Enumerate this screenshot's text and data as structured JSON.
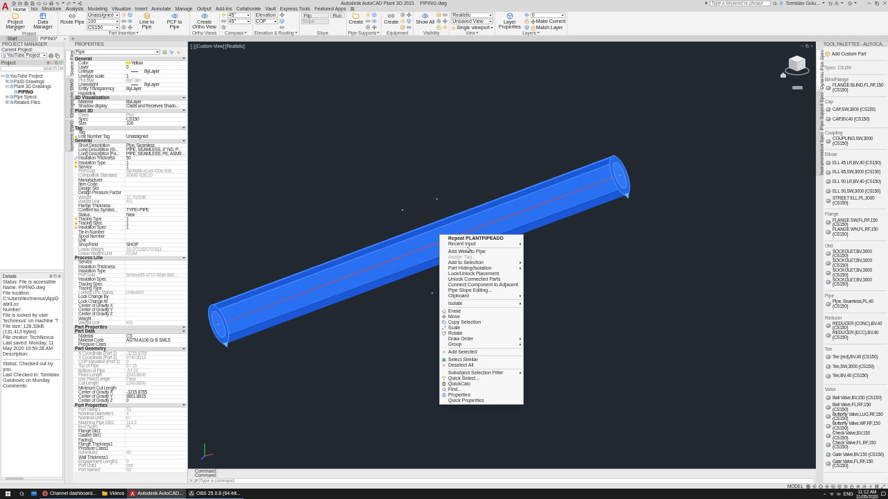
{
  "title_bar": {
    "logo": "A",
    "app_title": "Autodesk AutoCAD Plant 3D 2021",
    "file_name": "PIPING.dwg",
    "search": {
      "placeholder": "Type a keyword or phrase"
    },
    "user": "Tomislav Golu..."
  },
  "ribbon": {
    "tabs": [
      {
        "label": "Home",
        "selected": true
      },
      {
        "label": "Iso",
        "selected": false
      },
      {
        "label": "Structure",
        "selected": false
      },
      {
        "label": "Analysis",
        "selected": false
      },
      {
        "label": "Modeling",
        "selected": false
      },
      {
        "label": "Visualize",
        "selected": false
      },
      {
        "label": "Insert",
        "selected": false
      },
      {
        "label": "Annotate",
        "selected": false
      },
      {
        "label": "Manage",
        "selected": false
      },
      {
        "label": "Output",
        "selected": false
      },
      {
        "label": "Add-ins",
        "selected": false
      },
      {
        "label": "Collaborate",
        "selected": false
      },
      {
        "label": "Vault",
        "selected": false
      },
      {
        "label": "Express Tools",
        "selected": false
      },
      {
        "label": "Featured Apps",
        "selected": false
      }
    ],
    "panels": [
      {
        "label": "Project",
        "menu": false,
        "items": [
          {
            "kind": "large",
            "label": "Project Manager",
            "menu": true
          },
          {
            "kind": "large",
            "label": "Data Manager",
            "menu": false
          }
        ]
      },
      {
        "label": "Part Insertion",
        "menu": true,
        "items": [
          {
            "kind": "large",
            "label": "Route Pipe",
            "menu": false
          },
          {
            "kind": "stack",
            "rows": [
              {
                "kind": "dropdown",
                "value": "Unassigned"
              },
              {
                "kind": "dropdown",
                "value": "100"
              },
              {
                "kind": "dropdown",
                "value": "CS150"
              }
            ]
          },
          {
            "kind": "icons"
          },
          {
            "kind": "icons"
          },
          {
            "kind": "large",
            "label": "Line to Pipe",
            "menu": false
          },
          {
            "kind": "large",
            "label": "PCF to Pipe",
            "menu": false
          }
        ]
      },
      {
        "label": "Ortho Views",
        "menu": false,
        "items": [
          {
            "kind": "large",
            "label": "Create Ortho View",
            "menu": false
          }
        ]
      },
      {
        "label": "Compass",
        "menu": true,
        "items": [
          {
            "kind": "icons"
          },
          {
            "kind": "stack",
            "rows": [
              {
                "kind": "dropdown",
                "value": "45°"
              },
              {
                "kind": "dropdown",
                "value": "45°"
              }
            ]
          }
        ]
      },
      {
        "label": "Elevation & Routing",
        "menu": true,
        "items": [
          {
            "kind": "stack",
            "rows": [
              {
                "kind": "field",
                "value": "Elevation",
                "disabled": false
              },
              {
                "kind": "dropdown",
                "value": "COP"
              }
            ]
          },
          {
            "kind": "icons"
          }
        ]
      },
      {
        "label": "Slope",
        "menu": false,
        "items": [
          {
            "kind": "stack",
            "rows": [
              {
                "kind": "boxbutton",
                "label": "Flip"
              },
              {
                "kind": "field",
                "placeholder": "Slope",
                "disabled": true
              }
            ]
          },
          {
            "kind": "stack",
            "rows": [
              {
                "kind": "boxbutton",
                "label": "Run"
              }
            ]
          }
        ]
      },
      {
        "label": "Pipe Supports",
        "menu": true,
        "items": [
          {
            "kind": "large",
            "label": "Create",
            "menu": false
          },
          {
            "kind": "icons"
          },
          {
            "kind": "icons"
          }
        ]
      },
      {
        "label": "Equipment",
        "menu": false,
        "items": [
          {
            "kind": "large",
            "label": "Create",
            "menu": false
          },
          {
            "kind": "icons"
          },
          {
            "kind": "icons"
          }
        ]
      },
      {
        "label": "Visibility",
        "menu": false,
        "items": [
          {
            "kind": "large",
            "label": "Show All",
            "menu": false
          },
          {
            "kind": "icons"
          },
          {
            "kind": "icons"
          }
        ]
      },
      {
        "label": "View",
        "menu": true,
        "items": [
          {
            "kind": "stack",
            "rows": [
              {
                "kind": "dropdown",
                "value": "Realistic"
              },
              {
                "kind": "dropdown",
                "value": "Unsaved View"
              },
              {
                "kind": "button",
                "label": "Single viewport",
                "menu": true
              }
            ]
          }
        ]
      },
      {
        "label": "Layers",
        "menu": true,
        "items": [
          {
            "kind": "large",
            "label": "Layer Properties",
            "menu": false
          },
          {
            "kind": "icons"
          },
          {
            "kind": "stack",
            "rows": [
              {
                "kind": "dropdown",
                "value": "0"
              },
              {
                "kind": "button",
                "label": "Make Current",
                "menu": false
              },
              {
                "kind": "button",
                "label": "Match Layer",
                "menu": false
              }
            ]
          }
        ]
      }
    ]
  },
  "file_tabs": [
    {
      "label": "Start",
      "selected": false
    },
    {
      "label": "PIPING*",
      "selected": true
    }
  ],
  "project_manager": {
    "title": "PROJECT MANAGER",
    "current_label": "Current Project:",
    "current_project": "YouTube Project",
    "section": "Project",
    "search": {
      "placeholder": "search"
    },
    "tree": [
      {
        "label": "YouTube Project",
        "expanded": true,
        "selected": false,
        "children": [
          {
            "label": "P&ID Drawings",
            "expanded": false,
            "selected": false
          },
          {
            "label": "Plant 3D Drawings",
            "expanded": true,
            "selected": false,
            "children": [
              {
                "label": "PIPING",
                "selected": true
              }
            ]
          },
          {
            "label": "Pipe Specs",
            "expanded": false,
            "selected": false
          },
          {
            "label": "Related Files",
            "expanded": false,
            "selected": false
          }
        ]
      }
    ],
    "side_tabs": [
      {
        "label": "Source Files",
        "selected": true
      },
      {
        "label": "Orthographic DWG",
        "selected": false
      },
      {
        "label": "Isometric DWG",
        "selected": false
      }
    ],
    "details": {
      "title": "Details",
      "lines": [
        "Status: File is accessible",
        "Name: PIPING.dwg",
        "File location: C:\\Users\\technexus\\AppData\\Loc",
        "Number:",
        "File is locked by user 'technexus' on machine 'T",
        "File size: 128.33kB (131,413 bytes)",
        "File creator: TechNexus",
        "Last saved: Monday, 11 May 2020 10:59:28 AM",
        "Description:"
      ],
      "checkin": [
        "Status: Checked out by you.",
        "Last Checked in: Tomislav Golubovic on Monday",
        "Comments:"
      ]
    }
  },
  "properties": {
    "title": "PROPERTIES",
    "selection": "Pipe",
    "sections": [
      {
        "title": "General",
        "expanded": true,
        "rows": [
          {
            "name": "Color",
            "value": "Yellow",
            "kind": "swatch",
            "color": "#ffff00",
            "disabled": false
          },
          {
            "name": "Layer",
            "value": "0",
            "kind": "text",
            "disabled": false
          },
          {
            "name": "Linetype",
            "value": "ByLayer",
            "kind": "linetype",
            "disabled": false
          },
          {
            "name": "Linetype scale",
            "value": "1",
            "kind": "text",
            "disabled": false
          },
          {
            "name": "Plot style",
            "value": "ByColor",
            "kind": "text",
            "disabled": true
          },
          {
            "name": "Lineweight",
            "value": "ByLayer",
            "kind": "linetype",
            "disabled": false
          },
          {
            "name": "Entity Transparency",
            "value": "ByLayer",
            "kind": "text",
            "disabled": false
          },
          {
            "name": "Hyperlink",
            "kind": "text",
            "disabled": false
          }
        ]
      },
      {
        "title": "3D Visualization",
        "expanded": true,
        "rows": [
          {
            "name": "Material",
            "value": "ByLayer",
            "kind": "text",
            "disabled": false
          },
          {
            "name": "Shadow display",
            "value": "Casts and Receives Shado...",
            "kind": "text",
            "disabled": false
          }
        ]
      },
      {
        "title": "Plant 3D",
        "expanded": true,
        "rows": [
          {
            "name": "Class",
            "value": "Pipe",
            "kind": "text",
            "disabled": true
          },
          {
            "name": "Spec",
            "value": "CS150",
            "kind": "text",
            "disabled": false
          },
          {
            "name": "Size",
            "value": "100",
            "kind": "text",
            "disabled": false
          }
        ]
      },
      {
        "title": "Tag",
        "expanded": true,
        "rows": [
          {
            "name": "Tag",
            "kind": "text",
            "disabled": false
          },
          {
            "name": "Line Number Tag",
            "value": "Unassigned",
            "kind": "linked",
            "disabled": false
          }
        ]
      },
      {
        "title": "General",
        "expanded": true,
        "rows": [
          {
            "name": "Short Description",
            "value": "Pipe, Seamless",
            "kind": "text",
            "disabled": false
          },
          {
            "name": "Long Description (Si...",
            "value": "PIPE, SEAMLESS, 4\" ND, P...",
            "kind": "text",
            "disabled": false
          },
          {
            "name": "Long Description (Fa...",
            "value": "PIPE, SEAMLESS, PE, ASME...",
            "kind": "text",
            "disabled": false
          },
          {
            "name": "Insulation Thickness",
            "value": "50",
            "kind": "edited",
            "disabled": false
          },
          {
            "name": "Insulation Type",
            "value": "1",
            "kind": "linked",
            "disabled": false
          },
          {
            "name": "Service",
            "value": "1",
            "kind": "linked",
            "disabled": false
          },
          {
            "name": "PnPGuid",
            "value": "fab4fa8b-e1ad-43de-8d6...",
            "kind": "text",
            "disabled": true
          },
          {
            "name": "Compatible Standard",
            "value": "ASME B36.10",
            "kind": "text",
            "disabled": true
          },
          {
            "name": "Manufacturer",
            "kind": "text",
            "disabled": false
          },
          {
            "name": "Item Code",
            "kind": "text",
            "disabled": false
          },
          {
            "name": "Design Std",
            "kind": "text",
            "disabled": false
          },
          {
            "name": "Design Pressure Factor",
            "kind": "text",
            "disabled": false
          },
          {
            "name": "Weight",
            "value": "37.702998",
            "kind": "text",
            "disabled": true
          },
          {
            "name": "Weight Unit",
            "value": "KG",
            "kind": "text",
            "disabled": true
          },
          {
            "name": "Flange Thickness",
            "kind": "text",
            "disabled": false
          },
          {
            "name": "Content Iso Symbol...",
            "value": "TYPE=PIPE",
            "kind": "text",
            "disabled": false
          },
          {
            "name": "Status",
            "value": "New",
            "kind": "text",
            "disabled": false
          },
          {
            "name": "Tracing Type",
            "value": "1",
            "kind": "linked",
            "disabled": false
          },
          {
            "name": "Tracing Spec",
            "value": "1",
            "kind": "linked",
            "disabled": false
          },
          {
            "name": "Insulation Spec",
            "value": "1",
            "kind": "linked",
            "disabled": false
          },
          {
            "name": "Tie-In Number",
            "kind": "text",
            "disabled": false
          },
          {
            "name": "Spool Number",
            "kind": "text",
            "disabled": false
          },
          {
            "name": "Unit",
            "kind": "text",
            "disabled": false
          },
          {
            "name": "Shop/Field",
            "value": "SHOP",
            "kind": "text",
            "disabled": false
          },
          {
            "name": "Linear Weight",
            "value": "16.0721820707611",
            "kind": "text",
            "disabled": true
          },
          {
            "name": "Linear Weight Unit",
            "value": "KG/M",
            "kind": "text",
            "disabled": true
          }
        ]
      },
      {
        "title": "Process Line",
        "expanded": true,
        "rows": [
          {
            "name": "Service",
            "kind": "text",
            "disabled": false
          },
          {
            "name": "Insulation Thickness",
            "kind": "text",
            "disabled": false
          },
          {
            "name": "Insulation Type",
            "kind": "text",
            "disabled": false
          },
          {
            "name": "PnPGuid",
            "value": "5e0eee85-a710-40ab-8a6...",
            "kind": "text",
            "disabled": true
          },
          {
            "name": "Insulation Spec",
            "kind": "text",
            "disabled": false
          },
          {
            "name": "Tracing Spec",
            "kind": "text",
            "disabled": false
          },
          {
            "name": "Tracing Type",
            "kind": "text",
            "disabled": false
          },
          {
            "name": "Locked Line Status",
            "value": "Unlocked",
            "kind": "text",
            "disabled": true
          },
          {
            "name": "Lock Change By",
            "kind": "text",
            "disabled": false
          },
          {
            "name": "Lock Change At",
            "kind": "text",
            "disabled": false
          },
          {
            "name": "Center of Gravity X",
            "kind": "text",
            "disabled": false
          },
          {
            "name": "Center of Gravity Y",
            "kind": "text",
            "disabled": false
          },
          {
            "name": "Center of Gravity Z",
            "kind": "text",
            "disabled": false
          },
          {
            "name": "Weight",
            "kind": "text",
            "disabled": false
          },
          {
            "name": "Weight Unit",
            "value": "KG",
            "kind": "text",
            "disabled": true
          }
        ]
      },
      {
        "title": "Part Properties",
        "expanded": true
      },
      {
        "title": "Part Data",
        "expanded": true,
        "rows": [
          {
            "name": "Material",
            "value": "CS",
            "kind": "text",
            "disabled": false
          },
          {
            "name": "Material Code",
            "value": "ASTM A106 Gr B SMLS",
            "kind": "text",
            "disabled": false
          },
          {
            "name": "Pressure Class",
            "kind": "text",
            "disabled": false
          }
        ]
      },
      {
        "title": "Part Geometry",
        "expanded": true,
        "rows": [
          {
            "name": "X Coordinate (Port 1)",
            "value": "-3215.8785",
            "kind": "text",
            "disabled": true
          },
          {
            "name": "Y Coordinate (Port 1)",
            "value": "9740.8513",
            "kind": "text",
            "disabled": true
          },
          {
            "name": "COP Elevation (Port 1)",
            "value": "0",
            "kind": "text",
            "disabled": true
          },
          {
            "name": "Top of Pipe",
            "value": "57.15",
            "kind": "text",
            "disabled": true
          },
          {
            "name": "Bottom of Pipe",
            "value": "-57.15",
            "kind": "text",
            "disabled": true
          },
          {
            "name": "Fixed Length",
            "value": "2343.8600",
            "kind": "text",
            "disabled": true
          },
          {
            "name": "Use Fixed Length",
            "value": "False",
            "kind": "text",
            "disabled": true
          },
          {
            "name": "Cut Length",
            "value": "2343.8600",
            "kind": "text",
            "disabled": true
          },
          {
            "name": "Minimum Cut Length",
            "kind": "text",
            "disabled": false
          },
          {
            "name": "Center of Gravity X",
            "value": "-3215.8785",
            "kind": "text",
            "disabled": false
          },
          {
            "name": "Center of Gravity Y",
            "value": "9801.8815",
            "kind": "text",
            "disabled": false
          },
          {
            "name": "Center of Gravity Z",
            "value": "0",
            "kind": "text",
            "disabled": false
          }
        ]
      },
      {
        "title": "Port Properties",
        "expanded": true,
        "rows": [
          {
            "name": "Port Name1",
            "value": "S1",
            "kind": "text",
            "disabled": true
          },
          {
            "name": "Nominal Diameter1",
            "value": "4",
            "kind": "text",
            "disabled": true
          },
          {
            "name": "Nominal Unit1",
            "value": "in",
            "kind": "text",
            "disabled": true
          },
          {
            "name": "Matching Pipe OD1",
            "value": "114.3",
            "kind": "text",
            "disabled": true
          },
          {
            "name": "End Type1",
            "value": "PL",
            "kind": "text",
            "disabled": true
          },
          {
            "name": "Flange Std1",
            "kind": "text",
            "disabled": false
          },
          {
            "name": "Gasket Std1",
            "kind": "text",
            "disabled": false
          },
          {
            "name": "Facing1",
            "kind": "text",
            "disabled": false
          },
          {
            "name": "Flange Thickness1",
            "kind": "text",
            "disabled": false
          },
          {
            "name": "Pressure Class1",
            "kind": "text",
            "disabled": false
          },
          {
            "name": "Schedule1",
            "value": "40",
            "kind": "text",
            "disabled": true
          },
          {
            "name": "Wall Thickness1",
            "kind": "text",
            "disabled": false
          },
          {
            "name": "Engagement Length1",
            "value": "0",
            "kind": "text",
            "disabled": true
          },
          {
            "name": "Port Unit1",
            "value": "mm",
            "kind": "text",
            "disabled": true
          },
          {
            "name": "Port Name2",
            "value": "S2",
            "kind": "text",
            "disabled": true
          }
        ]
      }
    ]
  },
  "viewport": {
    "controls": [
      "[-]",
      "[Custom View]",
      "[Realistic]"
    ]
  },
  "context_menu": {
    "items": [
      {
        "kind": "plain",
        "label": "Repeat PLANTPIPEADD",
        "submenu": false,
        "disabled": false,
        "default": true
      },
      {
        "kind": "plain",
        "label": "Recent Input",
        "submenu": true,
        "disabled": false,
        "default": false
      },
      {
        "kind": "separator"
      },
      {
        "kind": "plain",
        "label": "Add Weld to Pipe",
        "submenu": false,
        "disabled": false,
        "default": false
      },
      {
        "kind": "plain",
        "label": "Assign Tag...",
        "submenu": false,
        "disabled": true,
        "default": false
      },
      {
        "kind": "plain",
        "label": "Add to Selection",
        "submenu": true,
        "disabled": false,
        "default": false
      },
      {
        "kind": "plain",
        "label": "Part Hiding/Isolation",
        "submenu": true,
        "disabled": false,
        "default": false
      },
      {
        "kind": "plain",
        "label": "Lock/Unlock Placement",
        "submenu": false,
        "disabled": false,
        "default": false
      },
      {
        "kind": "plain",
        "label": "Unlock Connected Parts",
        "submenu": false,
        "disabled": false,
        "default": false
      },
      {
        "kind": "plain",
        "label": "Connect Component to Adjacent",
        "submenu": false,
        "disabled": false,
        "default": false
      },
      {
        "kind": "plain",
        "label": "Pipe Slope Editing...",
        "submenu": false,
        "disabled": false,
        "default": false
      },
      {
        "kind": "plain",
        "label": "Clipboard",
        "submenu": true,
        "disabled": false,
        "default": false
      },
      {
        "kind": "separator"
      },
      {
        "kind": "plain",
        "label": "Isolate",
        "submenu": true,
        "disabled": false,
        "default": false
      },
      {
        "kind": "separator"
      },
      {
        "kind": "erase",
        "label": "Erase",
        "submenu": false,
        "disabled": false,
        "default": false
      },
      {
        "kind": "move",
        "label": "Move",
        "submenu": false,
        "disabled": false,
        "default": false
      },
      {
        "kind": "copy",
        "label": "Copy Selection",
        "submenu": false,
        "disabled": false,
        "default": false
      },
      {
        "kind": "scale",
        "label": "Scale",
        "submenu": false,
        "disabled": false,
        "default": false
      },
      {
        "kind": "rotate",
        "label": "Rotate",
        "submenu": false,
        "disabled": false,
        "default": false
      },
      {
        "kind": "plain",
        "label": "Draw Order",
        "submenu": true,
        "disabled": false,
        "default": false
      },
      {
        "kind": "plain",
        "label": "Group",
        "submenu": true,
        "disabled": false,
        "default": false
      },
      {
        "kind": "separator"
      },
      {
        "kind": "add",
        "label": "Add Selected",
        "submenu": false,
        "disabled": false,
        "default": false
      },
      {
        "kind": "separator"
      },
      {
        "kind": "similar",
        "label": "Select Similar",
        "submenu": false,
        "disabled": false,
        "default": false
      },
      {
        "kind": "deselect",
        "label": "Deselect All",
        "submenu": false,
        "disabled": false,
        "default": false
      },
      {
        "kind": "separator"
      },
      {
        "kind": "plain",
        "label": "Subobject Selection Filter",
        "submenu": true,
        "disabled": false,
        "default": false
      },
      {
        "kind": "quickselect",
        "label": "Quick Select...",
        "submenu": false,
        "disabled": false,
        "default": false
      },
      {
        "kind": "calc",
        "label": "QuickCalc",
        "submenu": false,
        "disabled": false,
        "default": false
      },
      {
        "kind": "find",
        "label": "Find...",
        "submenu": false,
        "disabled": false,
        "default": false
      },
      {
        "kind": "properties",
        "label": "Properties",
        "submenu": false,
        "disabled": false,
        "default": false
      },
      {
        "kind": "plain",
        "label": "Quick Properties",
        "submenu": false,
        "disabled": false,
        "default": false
      }
    ]
  },
  "command_line": {
    "history": [
      "Command:",
      "Command:"
    ],
    "placeholder": "Type a command"
  },
  "tool_palettes": {
    "title": "TOOL PALETTES - AUTOCA...",
    "tabs": [
      {
        "label": "Dynamic Pipe Spec",
        "selected": true
      },
      {
        "label": "Pipe Support Spec",
        "selected": false
      },
      {
        "label": "Instrumentation Spec",
        "selected": false
      }
    ],
    "add_part": "Add Custom Part",
    "spec": "Spec: CS150",
    "groups": [
      {
        "name": "BlindFlange",
        "items": [
          "FLANGE BLIND,FL,RF,150 (CS150)"
        ]
      },
      {
        "name": "Cap",
        "items": [
          "CAP,SW,3000 (CS150)",
          "CAP,BV,40 (CS150)"
        ]
      },
      {
        "name": "Coupling",
        "items": [
          "COUPLING,SW,3000 (CS150)"
        ]
      },
      {
        "name": "Elbow",
        "items": [
          "ELL 45 LR,BV,40 (CS150)",
          "ELL 45,SW,3000 (CS150)",
          "ELL 90 LR,BV,40 (CS150)",
          "ELL 90,SW,3000 (CS150)",
          "STREET ELL,PL,3000 (CS150)"
        ]
      },
      {
        "name": "Flange",
        "items": [
          "FLANGE SW,FL,RF,150 (CS150)",
          "FLANGE WN,FL,RF,150 (CS150)"
        ]
      },
      {
        "name": "Olet",
        "items": [
          "SOCKOLET,BV,3000 (CS150)",
          "SOCKOLET,BV,3000 (CS150)",
          "SOCKOLET,BV,3000 (CS150)",
          "SOCKOLET,BV,3000 (CS150)"
        ]
      },
      {
        "name": "Pipe",
        "items": [
          "Pipe, Seamless,PL,40 (CS150)"
        ]
      },
      {
        "name": "Reducer",
        "items": [
          "REDUCER (CONC),BV,40 (CS150)",
          "REDUCER (ECC),BV,40 (CS150)"
        ]
      },
      {
        "name": "Tee",
        "items": [
          "Tee (red),BV,40 (CS150)",
          "Tee,SW,3000 (CS150)",
          "Tee,BV,40 (CS150)"
        ]
      },
      {
        "name": "Valve",
        "items": [
          "Ball Valve,BV,150 (CS150)",
          "Ball Valve,FL,RF,150 (CS150)",
          "Butterfly Valve,LUG,RF,150 (CS150)",
          "Butterfly Valve,WF,RF,150 (CS150)",
          "Check Valve,BV,150 (CS150)",
          "Check Valve,FL,RF,150 (CS150)",
          "Gate Valve,BV,150 (CS150)",
          "Gate Valve,FL,RF,150 (CS150)"
        ]
      }
    ]
  },
  "status_bar": {
    "mode": "MODEL"
  },
  "taskbar": {
    "apps": [
      {
        "kind": "mail",
        "active": false
      },
      {
        "kind": "browser",
        "label": "Channel dashboard...",
        "active": false
      },
      {
        "kind": "folder",
        "label": "Videos",
        "active": false
      },
      {
        "kind": "cad",
        "label": "Autodesk AutoCAD...",
        "active": true
      },
      {
        "kind": "recorder",
        "label": "OBS 25.0.8 (64-bit...",
        "active": false
      }
    ],
    "language": "ENG",
    "time": "11:12 AM",
    "date": "11/05/2020"
  }
}
